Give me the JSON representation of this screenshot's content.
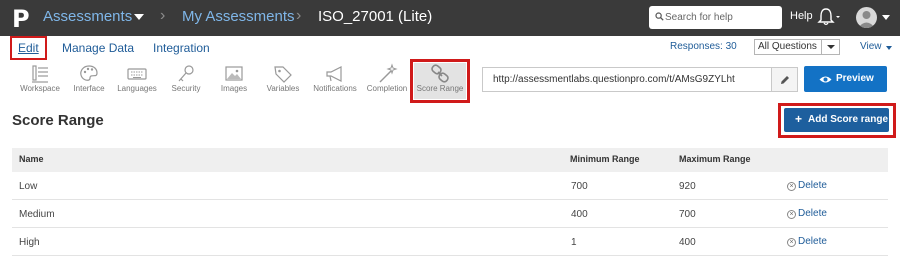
{
  "header": {
    "logo": "P",
    "crumbs": [
      "Assessments",
      "My Assessments",
      "ISO_27001 (Lite)"
    ],
    "search_placeholder": "Search for help",
    "help_label": "Help"
  },
  "subnav": {
    "tabs": [
      "Edit",
      "Manage Data",
      "Integration"
    ],
    "responses": "Responses: 30",
    "filter_value": "All Questions",
    "view_label": "View"
  },
  "toolbar": {
    "items": [
      {
        "label": "Workspace",
        "icon": "workspace-icon"
      },
      {
        "label": "Interface",
        "icon": "palette-icon"
      },
      {
        "label": "Languages",
        "icon": "keyboard-icon"
      },
      {
        "label": "Security",
        "icon": "key-icon"
      },
      {
        "label": "Images",
        "icon": "image-icon"
      },
      {
        "label": "Variables",
        "icon": "tag-icon"
      },
      {
        "label": "Notifications",
        "icon": "megaphone-icon"
      },
      {
        "label": "Completion",
        "icon": "wand-icon"
      },
      {
        "label": "Score Range",
        "icon": "chain-icon"
      }
    ],
    "url": "http://assessmentlabs.questionpro.com/t/AMsG9ZYLht",
    "preview_label": "Preview"
  },
  "page": {
    "title": "Score Range",
    "add_button": "Add Score range"
  },
  "table": {
    "columns": [
      "Name",
      "Minimum Range",
      "Maximum Range"
    ],
    "rows": [
      {
        "name": "Low",
        "min": "700",
        "max": "920",
        "action": "Delete"
      },
      {
        "name": "Medium",
        "min": "400",
        "max": "700",
        "action": "Delete"
      },
      {
        "name": "High",
        "min": "1",
        "max": "400",
        "action": "Delete"
      }
    ]
  },
  "colors": {
    "topbar": "#3a3a3a",
    "link": "#1f5c98",
    "primary_button": "#1372c5",
    "highlight_border": "#d01a1a"
  }
}
